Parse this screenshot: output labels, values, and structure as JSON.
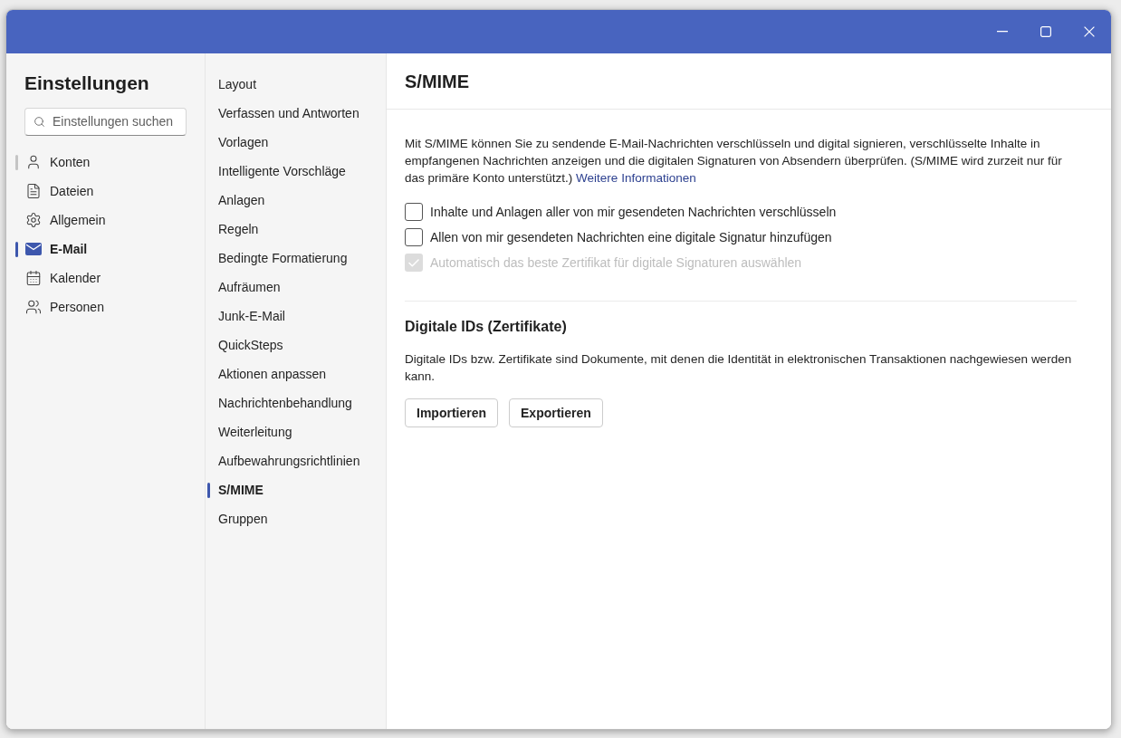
{
  "sidebar": {
    "title": "Einstellungen",
    "search": {
      "placeholder": "Einstellungen suchen"
    },
    "items": [
      {
        "label": "Konten",
        "selected": false,
        "hovered": true
      },
      {
        "label": "Dateien",
        "selected": false,
        "hovered": false
      },
      {
        "label": "Allgemein",
        "selected": false,
        "hovered": false
      },
      {
        "label": "E-Mail",
        "selected": true,
        "hovered": false
      },
      {
        "label": "Kalender",
        "selected": false,
        "hovered": false
      },
      {
        "label": "Personen",
        "selected": false,
        "hovered": false
      }
    ]
  },
  "subnav": {
    "items": [
      {
        "label": "Layout",
        "selected": false
      },
      {
        "label": "Verfassen und Antworten",
        "selected": false
      },
      {
        "label": "Vorlagen",
        "selected": false
      },
      {
        "label": "Intelligente Vorschläge",
        "selected": false
      },
      {
        "label": "Anlagen",
        "selected": false
      },
      {
        "label": "Regeln",
        "selected": false
      },
      {
        "label": "Bedingte Formatierung",
        "selected": false
      },
      {
        "label": "Aufräumen",
        "selected": false
      },
      {
        "label": "Junk-E-Mail",
        "selected": false
      },
      {
        "label": "QuickSteps",
        "selected": false
      },
      {
        "label": "Aktionen anpassen",
        "selected": false
      },
      {
        "label": "Nachrichtenbehandlung",
        "selected": false
      },
      {
        "label": "Weiterleitung",
        "selected": false
      },
      {
        "label": "Aufbewahrungsrichtlinien",
        "selected": false
      },
      {
        "label": "S/MIME",
        "selected": true
      },
      {
        "label": "Gruppen",
        "selected": false
      }
    ]
  },
  "content": {
    "title": "S/MIME",
    "description": "Mit S/MIME können Sie zu sendende E-Mail-Nachrichten verschlüsseln und digital signieren, verschlüsselte Inhalte in empfangenen Nachrichten anzeigen und die digitalen Signaturen von Absendern überprüfen. (S/MIME wird zurzeit nur für das primäre Konto unterstützt.)",
    "link": "Weitere Informationen",
    "options": [
      {
        "label": "Inhalte und Anlagen aller von mir gesendeten Nachrichten verschlüsseln",
        "checked": false,
        "disabled": false
      },
      {
        "label": "Allen von mir gesendeten Nachrichten eine digitale Signatur hinzufügen",
        "checked": false,
        "disabled": false
      },
      {
        "label": "Automatisch das beste Zertifikat für digitale Signaturen auswählen",
        "checked": true,
        "disabled": true
      }
    ],
    "section": {
      "title": "Digitale IDs (Zertifikate)",
      "description": "Digitale IDs bzw. Zertifikate sind Dokumente, mit denen die Identität in elektronischen Transaktionen nachgewiesen werden kann.",
      "buttons": [
        "Importieren",
        "Exportieren"
      ]
    }
  }
}
